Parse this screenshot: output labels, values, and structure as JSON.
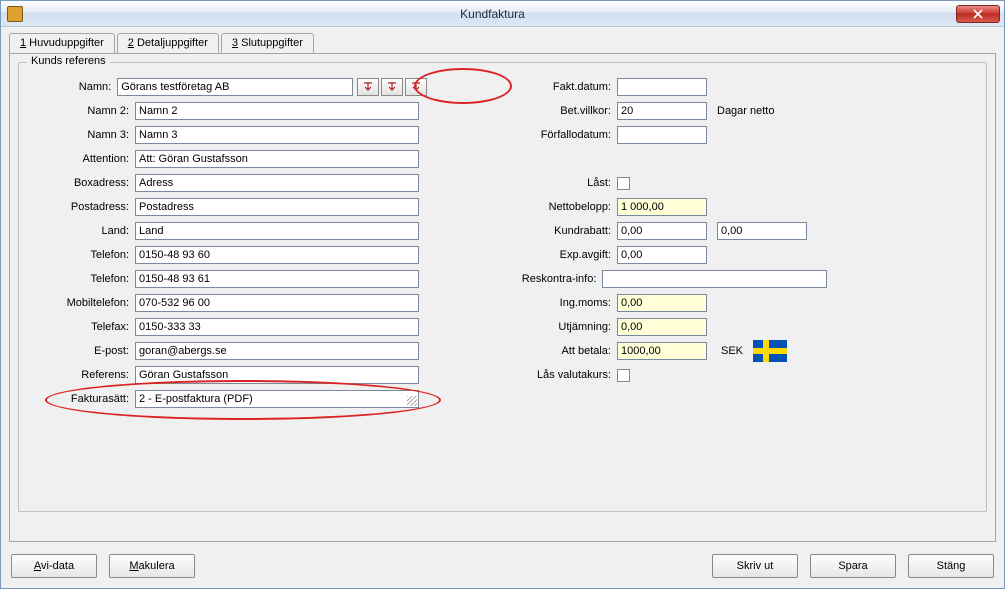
{
  "window": {
    "title": "Kundfaktura"
  },
  "tabs": {
    "t1_num": "1",
    "t1": " Huvuduppgifter",
    "t2_num": "2",
    "t2": " Detaljuppgifter",
    "t3_num": "3",
    "t3": " Slutuppgifter"
  },
  "group": {
    "title": "Kunds referens"
  },
  "left": {
    "namn_l": "Namn:",
    "namn_v": "Görans testföretag AB",
    "namn2_l": "Namn 2:",
    "namn2_v": "Namn 2",
    "namn3_l": "Namn 3:",
    "namn3_v": "Namn 3",
    "att_l": "Attention:",
    "att_v": "Att: Göran Gustafsson",
    "box_l": "Boxadress:",
    "box_v": "Adress",
    "post_l": "Postadress:",
    "post_v": "Postadress",
    "land_l": "Land:",
    "land_v": "Land",
    "tel1_l": "Telefon:",
    "tel1_v": "0150-48 93 60",
    "tel2_l": "Telefon:",
    "tel2_v": "0150-48 93 61",
    "mob_l": "Mobiltelefon:",
    "mob_v": "070-532 96 00",
    "fax_l": "Telefax:",
    "fax_v": "0150-333 33",
    "epost_l": "E-post:",
    "epost_v": "goran@abergs.se",
    "ref_l": "Referens:",
    "ref_v": "Göran Gustafsson",
    "fsatt_l": "Fakturasätt:",
    "fsatt_v": "2     - E-postfaktura (PDF)"
  },
  "right": {
    "faktdat_l": "Fakt.datum:",
    "faktdat_v": "",
    "betv_l": "Bet.villkor:",
    "betv_v": "20",
    "betv_after": "Dagar netto",
    "forf_l": "Förfallodatum:",
    "forf_v": "",
    "last_l": "Låst:",
    "netto_l": "Nettobelopp:",
    "netto_v": "1 000,00",
    "krab_l": "Kundrabatt:",
    "krab_v": "0,00",
    "krab_v2": "0,00",
    "exp_l": "Exp.avgift:",
    "exp_v": "0,00",
    "resk_l": "Reskontra-info:",
    "resk_v": "",
    "ing_l": "Ing.moms:",
    "ing_v": "0,00",
    "utj_l": "Utjämning:",
    "utj_v": "0,00",
    "att_l": "Att betala:",
    "att_v": "1000,00",
    "currency": "SEK",
    "lasv_l": "Lås valutakurs:"
  },
  "footer": {
    "avidata": "Avi-data",
    "makulera": "Makulera",
    "skrivut": "Skriv ut",
    "spara": "Spara",
    "stang": "Stäng"
  }
}
